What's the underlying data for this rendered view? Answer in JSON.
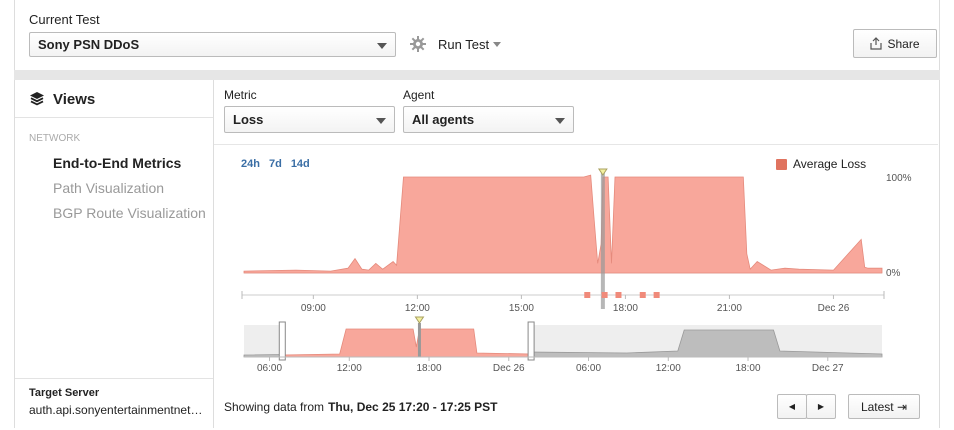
{
  "header": {
    "current_test_label": "Current Test",
    "current_test_value": "Sony PSN DDoS",
    "run_test_label": "Run Test",
    "share_label": "Share"
  },
  "sidebar": {
    "views_title": "Views",
    "section_label": "NETWORK",
    "items": [
      {
        "label": "End-to-End Metrics",
        "active": true
      },
      {
        "label": "Path Visualization",
        "active": false
      },
      {
        "label": "BGP Route Visualization",
        "active": false
      }
    ],
    "target_label": "Target Server",
    "target_value": "auth.api.sonyentertainmentnet…"
  },
  "filters": {
    "metric_label": "Metric",
    "metric_value": "Loss",
    "agent_label": "Agent",
    "agent_value": "All agents"
  },
  "range_buttons": [
    "24h",
    "7d",
    "14d"
  ],
  "colors": {
    "loss": "#f8a79b",
    "loss_legend": "#e0735f",
    "overview_gray": "#bdbdbd",
    "range_link": "#3a6ea5"
  },
  "chart_data": {
    "type": "area",
    "title": "",
    "legend": [
      "Average Loss"
    ],
    "legend_position": "top-right",
    "ylim": [
      0,
      100
    ],
    "y_tick_labels": [
      "100%",
      "0%"
    ],
    "x_tick_labels": [
      "09:00",
      "12:00",
      "15:00",
      "18:00",
      "21:00",
      "Dec 26"
    ],
    "series": [
      {
        "name": "Average Loss",
        "x_hours": [
          7.0,
          8.5,
          9.5,
          10.0,
          10.2,
          10.4,
          10.6,
          10.8,
          11.0,
          11.3,
          11.4,
          11.6,
          16.8,
          17.0,
          17.1,
          17.2,
          17.3,
          17.35,
          17.5,
          17.6,
          17.7,
          17.8,
          21.4,
          21.5,
          21.6,
          21.8,
          22.2,
          22.6,
          23.0,
          24.0,
          24.8,
          24.9,
          25.0,
          25.4
        ],
        "values": [
          2,
          3,
          2,
          5,
          15,
          4,
          3,
          10,
          4,
          12,
          8,
          100,
          100,
          102,
          55,
          10,
          30,
          100,
          100,
          10,
          100,
          100,
          100,
          20,
          4,
          12,
          3,
          5,
          4,
          3,
          35,
          6,
          5,
          5
        ]
      }
    ],
    "events_hours": [
      16.9,
      17.4,
      17.8,
      18.5,
      18.9
    ],
    "overview": {
      "x_tick_labels": [
        "06:00",
        "12:00",
        "18:00",
        "Dec 26",
        "06:00",
        "12:00",
        "18:00",
        "Dec 27"
      ]
    }
  },
  "footer": {
    "showing_prefix": "Showing data from",
    "showing_value": "Thu, Dec 25 17:20 - 17:25 PST",
    "prev_icon": "◀",
    "next_icon": "▶",
    "latest_label": "Latest ⇥"
  }
}
